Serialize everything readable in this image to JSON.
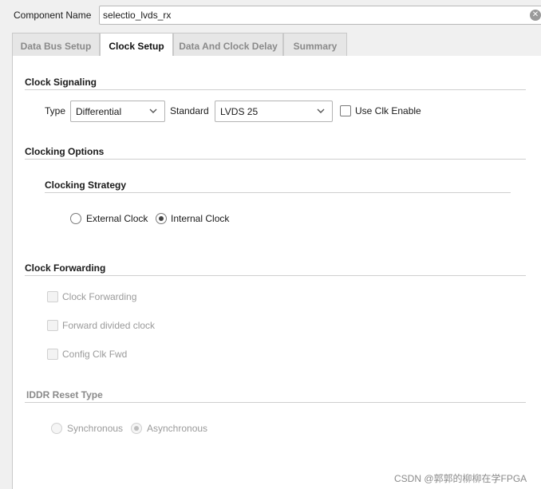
{
  "component": {
    "label": "Component Name",
    "value": "selectio_lvds_rx",
    "clear_icon": "clear-circle-icon"
  },
  "tabs": [
    {
      "label": "Data Bus Setup",
      "active": false
    },
    {
      "label": "Clock Setup",
      "active": true
    },
    {
      "label": "Data And Clock Delay",
      "active": false
    },
    {
      "label": "Summary",
      "active": false
    }
  ],
  "clock_signaling": {
    "title": "Clock Signaling",
    "type_label": "Type",
    "type_value": "Differential",
    "standard_label": "Standard",
    "standard_value": "LVDS 25",
    "clk_enable_label": "Use Clk Enable",
    "clk_enable_checked": false
  },
  "clocking_options": {
    "title": "Clocking Options",
    "strategy_title": "Clocking Strategy",
    "external_label": "External Clock",
    "internal_label": "Internal Clock",
    "selected": "Internal Clock"
  },
  "clock_forwarding": {
    "title": "Clock Forwarding",
    "options": [
      {
        "label": "Clock Forwarding",
        "checked": false,
        "enabled": false
      },
      {
        "label": "Forward divided clock",
        "checked": false,
        "enabled": false
      },
      {
        "label": "Config Clk Fwd",
        "checked": false,
        "enabled": false
      }
    ]
  },
  "iddr_reset": {
    "title": "IDDR Reset Type",
    "sync_label": "Synchronous",
    "async_label": "Asynchronous",
    "selected": "Asynchronous",
    "enabled": false
  },
  "watermark": "CSDN @郭郭的柳柳在学FPGA"
}
